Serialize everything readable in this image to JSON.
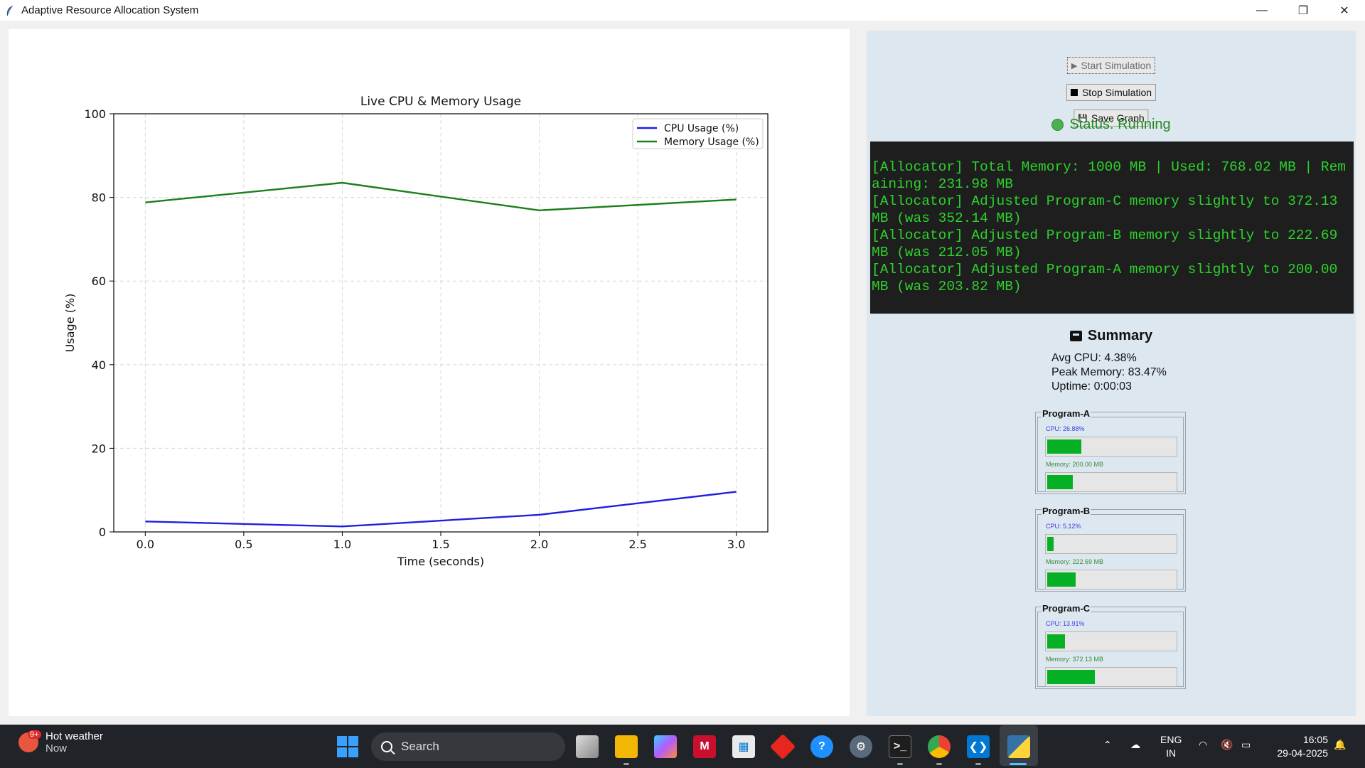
{
  "window": {
    "title": "Adaptive Resource Allocation System",
    "minimize": "—",
    "restore": "❐",
    "close": "✕"
  },
  "chart_data": {
    "type": "line",
    "title": "Live CPU & Memory Usage",
    "xlabel": "Time (seconds)",
    "ylabel": "Usage (%)",
    "x": [
      0.0,
      1.0,
      2.0,
      3.0
    ],
    "series": [
      {
        "name": "CPU Usage (%)",
        "color": "#1f1fe0",
        "values": [
          2.5,
          1.3,
          4.1,
          9.6
        ]
      },
      {
        "name": "Memory Usage (%)",
        "color": "#1a7f1a",
        "values": [
          78.8,
          83.5,
          76.9,
          79.5
        ]
      }
    ],
    "xlim": [
      -0.16,
      3.16
    ],
    "ylim": [
      0,
      100
    ],
    "xticks": [
      "0.0",
      "0.5",
      "1.0",
      "1.5",
      "2.0",
      "2.5",
      "3.0"
    ],
    "yticks": [
      "0",
      "20",
      "40",
      "60",
      "80",
      "100"
    ],
    "grid": true,
    "legend": "top-right"
  },
  "controls": {
    "start_label": "Start Simulation",
    "start_glyph": "▶",
    "stop_label": "Stop Simulation",
    "save_label": "Save Graph",
    "save_glyph": "💾"
  },
  "status": {
    "text": "Status: Running",
    "color": "#228B22"
  },
  "console": {
    "lines": [
      "[Allocator] Total Memory: 1000 MB | Used: 768.02 MB | Remaining: 231.98 MB",
      "[Allocator] Adjusted Program-C memory slightly to 372.13 MB (was 352.14 MB)",
      "[Allocator] Adjusted Program-B memory slightly to 222.69 MB (was 212.05 MB)",
      "[Allocator] Adjusted Program-A memory slightly to 200.00 MB (was 203.82 MB)"
    ]
  },
  "summary": {
    "title": "Summary",
    "avg_cpu": "Avg CPU: 4.38%",
    "peak_memory": "Peak Memory: 83.47%",
    "uptime": "Uptime: 0:00:03"
  },
  "programs": [
    {
      "name": "Program-A",
      "cpu_label": "CPU: 26.88%",
      "cpu_fraction": 0.2688,
      "mem_label": "Memory: 200.00 MB",
      "mem_fraction": 0.2
    },
    {
      "name": "Program-B",
      "cpu_label": "CPU: 5.12%",
      "cpu_fraction": 0.0512,
      "mem_label": "Memory: 222.69 MB",
      "mem_fraction": 0.2227
    },
    {
      "name": "Program-C",
      "cpu_label": "CPU: 13.91%",
      "cpu_fraction": 0.1391,
      "mem_label": "Memory: 372.13 MB",
      "mem_fraction": 0.3721
    }
  ],
  "taskbar": {
    "weather_title": "Hot weather",
    "weather_sub": "Now",
    "weather_badge": "9+",
    "search_placeholder": "Search",
    "lang_top": "ENG",
    "lang_bottom": "IN",
    "time": "16:05",
    "date": "29-04-2025"
  }
}
